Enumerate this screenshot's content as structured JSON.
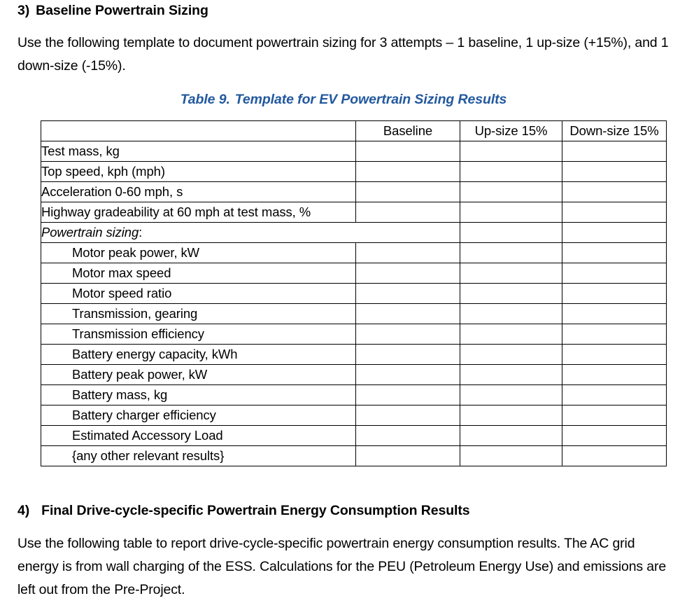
{
  "section3": {
    "number": "3)",
    "title": "Baseline Powertrain Sizing",
    "paragraph": "Use the following template to document powertrain sizing for 3 attempts – 1 baseline, 1 up-size (+15%), and 1 down-size (-15%)."
  },
  "table_caption": {
    "label": "Table 9.",
    "title": "Template for EV Powertrain Sizing Results",
    "color": "#23599E"
  },
  "table": {
    "columns": [
      "",
      "Baseline",
      "Up-size 15%",
      "Down-size 15%"
    ],
    "rows": [
      {
        "label": "Test mass, kg",
        "indent": false,
        "italic": false,
        "merged": false,
        "values": [
          "",
          "",
          ""
        ]
      },
      {
        "label": "Top speed, kph (mph)",
        "indent": false,
        "italic": false,
        "merged": false,
        "values": [
          "",
          "",
          ""
        ]
      },
      {
        "label": "Acceleration 0-60 mph, s",
        "indent": false,
        "italic": false,
        "merged": false,
        "values": [
          "",
          "",
          ""
        ]
      },
      {
        "label": "Highway gradeability at 60 mph at test mass, %",
        "indent": false,
        "italic": false,
        "merged": false,
        "values": [
          "",
          "",
          ""
        ]
      },
      {
        "label": "Powertrain sizing",
        "suffix": ":",
        "indent": false,
        "italic": true,
        "merged": true,
        "values": [
          "",
          ""
        ]
      },
      {
        "label": "Motor peak power, kW",
        "indent": true,
        "italic": false,
        "merged": false,
        "values": [
          "",
          "",
          ""
        ]
      },
      {
        "label": "Motor max speed",
        "indent": true,
        "italic": false,
        "merged": false,
        "values": [
          "",
          "",
          ""
        ]
      },
      {
        "label": "Motor speed ratio",
        "indent": true,
        "italic": false,
        "merged": false,
        "values": [
          "",
          "",
          ""
        ]
      },
      {
        "label": "Transmission, gearing",
        "indent": true,
        "italic": false,
        "merged": false,
        "values": [
          "",
          "",
          ""
        ]
      },
      {
        "label": "Transmission efficiency",
        "indent": true,
        "italic": false,
        "merged": false,
        "values": [
          "",
          "",
          ""
        ]
      },
      {
        "label": "Battery energy capacity, kWh",
        "indent": true,
        "italic": false,
        "merged": false,
        "values": [
          "",
          "",
          ""
        ]
      },
      {
        "label": "Battery peak power, kW",
        "indent": true,
        "italic": false,
        "merged": false,
        "values": [
          "",
          "",
          ""
        ]
      },
      {
        "label": "Battery mass, kg",
        "indent": true,
        "italic": false,
        "merged": false,
        "values": [
          "",
          "",
          ""
        ]
      },
      {
        "label": "Battery charger efficiency",
        "indent": true,
        "italic": false,
        "merged": false,
        "values": [
          "",
          "",
          ""
        ]
      },
      {
        "label": "Estimated Accessory Load",
        "indent": true,
        "italic": false,
        "merged": false,
        "values": [
          "",
          "",
          ""
        ]
      },
      {
        "label": "{any other relevant results}",
        "indent": true,
        "italic": false,
        "merged": false,
        "values": [
          "",
          "",
          ""
        ]
      }
    ]
  },
  "section4": {
    "number": "4)",
    "title": "Final Drive-cycle-specific Powertrain Energy Consumption Results",
    "paragraph": "Use the following table to report drive-cycle-specific powertrain energy consumption results.  The AC grid energy is from wall charging of the ESS.  Calculations for the PEU (Petroleum Energy Use) and emissions are left out from the Pre-Project."
  }
}
